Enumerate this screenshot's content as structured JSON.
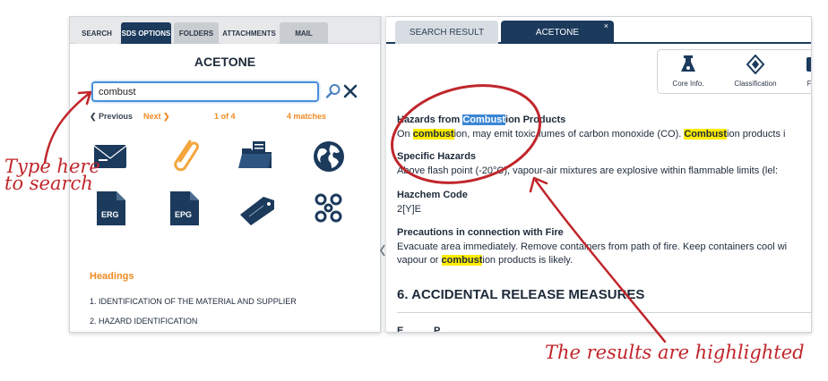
{
  "left_tabs": [
    "SEARCH",
    "SDS OPTIONS",
    "FOLDERS",
    "ATTACHMENTS",
    "MAIL"
  ],
  "left": {
    "title": "ACETONE",
    "search_value": "combust",
    "nav": {
      "previous": "Previous",
      "next": "Next",
      "count": "1 of 4",
      "matches": "4 matches"
    },
    "icons": [
      "envelope-icon",
      "paperclip-icon",
      "folder-icon",
      "globe-icon",
      "erg-document-icon",
      "epg-document-icon",
      "label-tag-icon",
      "chain-link-icon"
    ],
    "erg_label": "ERG",
    "epg_label": "EPG",
    "headings_title": "Headings",
    "headings": [
      "1. IDENTIFICATION OF THE MATERIAL AND SUPPLIER",
      "2. HAZARD IDENTIFICATION"
    ]
  },
  "right_tabs": {
    "search_result": "SEARCH RESULT",
    "acetone": "ACETONE",
    "close": "×"
  },
  "toolbar": {
    "core": "Core Info.",
    "classification": "Classification",
    "third": "Fi"
  },
  "content": {
    "h1": {
      "pre": "Hazards from ",
      "match": "Combust",
      "post": "ion Products"
    },
    "p1": {
      "a": "On ",
      "b": "combust",
      "c": "ion, may emit toxic fumes of carbon monoxide (CO). ",
      "d": "Combust",
      "e": "ion products i"
    },
    "h2": "Specific Hazards",
    "p2": "Above flash point (-20°C), vapour-air mixtures are explosive within flammable limits (lel:",
    "h3": "Hazchem Code",
    "p3": "2[Y]E",
    "h4": "Precautions in connection with Fire",
    "p4": "Evacuate area immediately. Remove containers from path of fire. Keep containers cool wi",
    "p5": {
      "a": "vapour or ",
      "b": "combust",
      "c": "ion products is likely."
    },
    "big": "6. ACCIDENTAL RELEASE MEASURES",
    "cut": "E..........  P........ ."
  },
  "annotations": {
    "left_line1": "Type here",
    "left_line2": "to search",
    "bottom": "The results are highlighted"
  },
  "colors": {
    "navy": "#1b3a5c",
    "orange": "#f08a24",
    "highlight_yellow": "#ffeb00",
    "highlight_blue": "#3b86d6",
    "annotation_red": "#c0262b"
  }
}
